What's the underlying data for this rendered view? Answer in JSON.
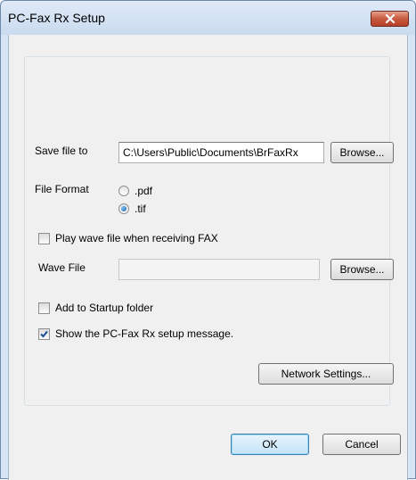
{
  "window": {
    "title": "PC-Fax Rx Setup",
    "close_icon": "close-icon"
  },
  "save_file": {
    "label": "Save file to",
    "value": "C:\\Users\\Public\\Documents\\BrFaxRx",
    "browse_label": "Browse..."
  },
  "file_format": {
    "label": "File Format",
    "options": [
      {
        "label": ".pdf",
        "selected": false
      },
      {
        "label": ".tif",
        "selected": true
      }
    ]
  },
  "play_wave": {
    "label": "Play wave file when receiving FAX",
    "checked": false
  },
  "wave_file": {
    "label": "Wave File",
    "value": "",
    "browse_label": "Browse..."
  },
  "startup": {
    "label": "Add to Startup folder",
    "checked": false
  },
  "show_message": {
    "label": "Show the PC-Fax Rx setup message.",
    "checked": true
  },
  "network_settings_label": "Network Settings...",
  "footer": {
    "ok_label": "OK",
    "cancel_label": "Cancel"
  }
}
